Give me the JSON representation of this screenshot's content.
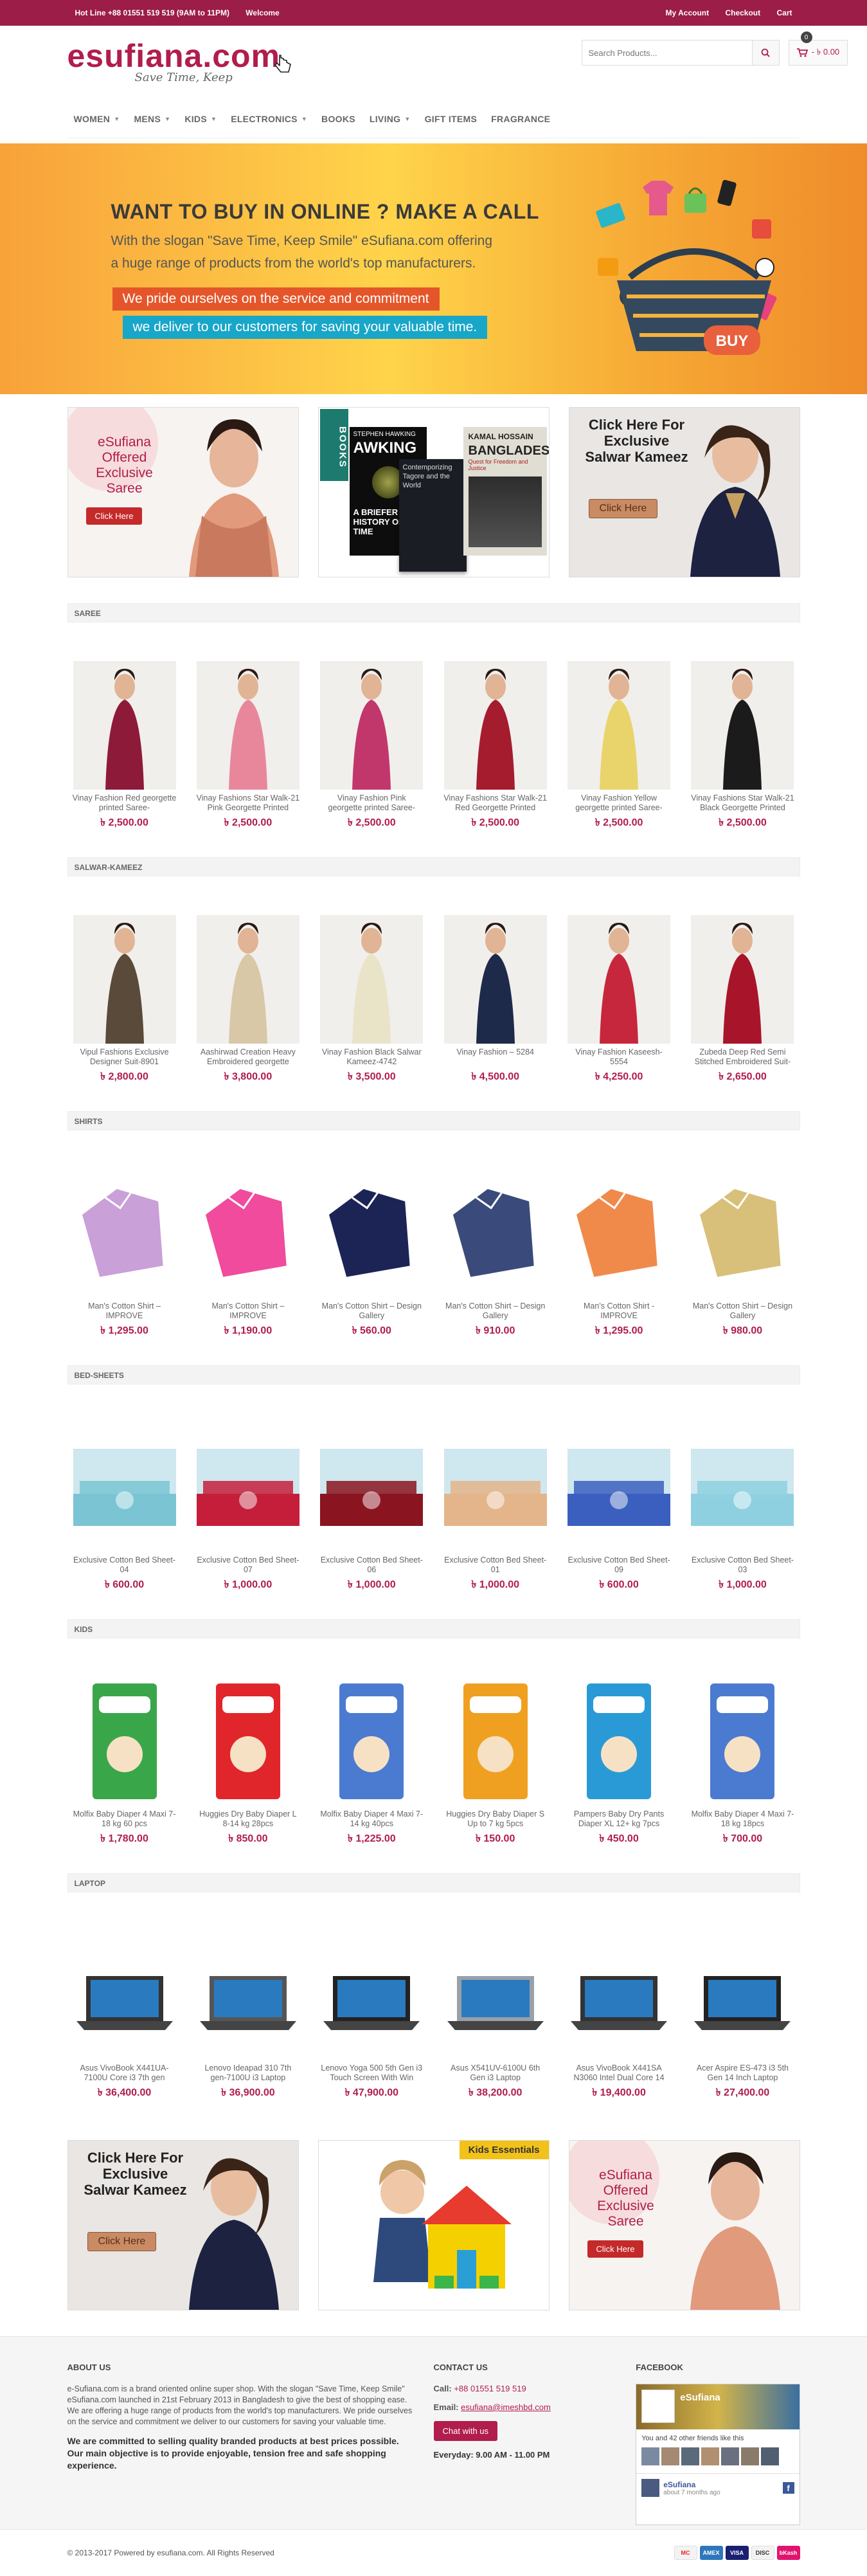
{
  "topbar": {
    "hotline": "Hot Line +88 01551 519 519 (9AM to 11PM)",
    "welcome": "Welcome",
    "my_account": "My Account",
    "checkout": "Checkout",
    "cart": "Cart"
  },
  "header": {
    "logo_text": "esufiana.com",
    "logo_tagline": "Save Time, Keep",
    "search_placeholder": "Search Products...",
    "cart_count": "0",
    "cart_total": "- ৳ 0.00"
  },
  "nav": [
    {
      "label": "WOMEN",
      "dropdown": true
    },
    {
      "label": "MENS",
      "dropdown": true
    },
    {
      "label": "KIDS",
      "dropdown": true
    },
    {
      "label": "ELECTRONICS",
      "dropdown": true
    },
    {
      "label": "BOOKS",
      "dropdown": false
    },
    {
      "label": "LIVING",
      "dropdown": true
    },
    {
      "label": "GIFT ITEMS",
      "dropdown": false
    },
    {
      "label": "FRAGRANCE",
      "dropdown": false
    }
  ],
  "hero": {
    "heading": "WANT TO BUY IN ONLINE ? MAKE A CALL",
    "line1": "With the slogan \"Save Time, Keep Smile\" eSufiana.com offering",
    "line2": "a huge range of products from the world's top manufacturers.",
    "bar1": "We pride ourselves on the service and commitment",
    "bar2": "we deliver to our customers for saving your valuable time.",
    "buy": "BUY"
  },
  "promos": {
    "saree_text": "eSufiana Offered Exclusive Saree",
    "saree_cta": "Click Here",
    "books_label": "BOOKS",
    "book1": "STEPHEN HAWKING",
    "book1_title": "A BRIEFER HISTORY OF TIME",
    "book2": "Contemporizing Tagore and the World",
    "book3": "KAMAL HOSSAIN",
    "book3_title": "BANGLADESH",
    "book3_sub": "Quest for Freedom and Justice",
    "kameez_text": "Click Here For Exclusive Salwar Kameez",
    "kameez_cta": "Click Here"
  },
  "sections": [
    {
      "title": "SAREE",
      "products": [
        {
          "name": "Vinay Fashion Red georgette printed Saree-",
          "price": "৳ 2,500.00"
        },
        {
          "name": "Vinay Fashions Star Walk-21 Pink Georgette Printed",
          "price": "৳ 2,500.00"
        },
        {
          "name": "Vinay Fashion Pink georgette printed Saree-",
          "price": "৳ 2,500.00"
        },
        {
          "name": "Vinay Fashions Star Walk-21 Red Georgette Printed",
          "price": "৳ 2,500.00"
        },
        {
          "name": "Vinay Fashion Yellow georgette printed Saree-",
          "price": "৳ 2,500.00"
        },
        {
          "name": "Vinay Fashions Star Walk-21 Black Georgette Printed",
          "price": "৳ 2,500.00"
        }
      ]
    },
    {
      "title": "SALWAR-KAMEEZ",
      "products": [
        {
          "name": "Vipul Fashions Exclusive Designer Suit-8901",
          "price": "৳ 2,800.00"
        },
        {
          "name": "Aashirwad Creation Heavy Embroidered georgette",
          "price": "৳ 3,800.00"
        },
        {
          "name": "Vinay Fashion Black Salwar Kameez-4742",
          "price": "৳ 3,500.00"
        },
        {
          "name": "Vinay Fashion – 5284",
          "price": "৳ 4,500.00"
        },
        {
          "name": "Vinay Fashion Kaseesh-5554",
          "price": "৳ 4,250.00"
        },
        {
          "name": "Zubeda Deep Red Semi Stitched Embroidered Suit-",
          "price": "৳ 2,650.00"
        }
      ]
    },
    {
      "title": "SHIRTS",
      "products": [
        {
          "name": "Man's Cotton Shirt – IMPROVE",
          "price": "৳ 1,295.00"
        },
        {
          "name": "Man's Cotton Shirt – IMPROVE",
          "price": "৳ 1,190.00"
        },
        {
          "name": "Man's Cotton Shirt – Design Gallery",
          "price": "৳ 560.00"
        },
        {
          "name": "Man's Cotton Shirt – Design Gallery",
          "price": "৳ 910.00"
        },
        {
          "name": "Man's Cotton Shirt - IMPROVE",
          "price": "৳ 1,295.00"
        },
        {
          "name": "Man's Cotton Shirt – Design Gallery",
          "price": "৳ 980.00"
        }
      ]
    },
    {
      "title": "BED-SHEETS",
      "products": [
        {
          "name": "Exclusive Cotton Bed Sheet-04",
          "price": "৳ 600.00"
        },
        {
          "name": "Exclusive Cotton Bed Sheet-07",
          "price": "৳ 1,000.00"
        },
        {
          "name": "Exclusive Cotton Bed Sheet-06",
          "price": "৳ 1,000.00"
        },
        {
          "name": "Exclusive Cotton Bed Sheet-01",
          "price": "৳ 1,000.00"
        },
        {
          "name": "Exclusive Cotton Bed Sheet-09",
          "price": "৳ 600.00"
        },
        {
          "name": "Exclusive Cotton Bed Sheet-03",
          "price": "৳ 1,000.00"
        }
      ]
    },
    {
      "title": "KIDS",
      "products": [
        {
          "name": "Molfix Baby Diaper 4 Maxi 7-18 kg 60 pcs",
          "price": "৳ 1,780.00"
        },
        {
          "name": "Huggies Dry Baby Diaper L 8-14 kg 28pcs",
          "price": "৳ 850.00"
        },
        {
          "name": "Molfix Baby Diaper 4 Maxi 7-14 kg 40pcs",
          "price": "৳ 1,225.00"
        },
        {
          "name": "Huggies Dry Baby Diaper S Up to 7 kg 5pcs",
          "price": "৳ 150.00"
        },
        {
          "name": "Pampers Baby Dry Pants Diaper XL 12+ kg 7pcs",
          "price": "৳ 450.00"
        },
        {
          "name": "Molfix Baby Diaper 4 Maxi 7-18 kg 18pcs",
          "price": "৳ 700.00"
        }
      ]
    },
    {
      "title": "LAPTOP",
      "products": [
        {
          "name": "Asus VivoBook X441UA-7100U Core i3 7th gen",
          "price": "৳ 36,400.00"
        },
        {
          "name": "Lenovo Ideapad 310 7th gen-7100U i3 Laptop",
          "price": "৳ 36,900.00"
        },
        {
          "name": "Lenovo Yoga 500 5th Gen i3 Touch Screen With Win",
          "price": "৳ 47,900.00"
        },
        {
          "name": "Asus X541UV-6100U 6th Gen i3 Laptop",
          "price": "৳ 38,200.00"
        },
        {
          "name": "Asus VivoBook X441SA N3060 Intel Dual Core 14",
          "price": "৳ 19,400.00"
        },
        {
          "name": "Acer Aspire ES-473 i3 5th Gen 14 Inch Laptop",
          "price": "৳ 27,400.00"
        }
      ]
    }
  ],
  "bottom_promos": {
    "kameez_text": "Click Here For Exclusive Salwar Kameez",
    "kameez_cta": "Click Here",
    "kids_label": "Kids Essentials",
    "saree_text": "eSufiana Offered Exclusive Saree",
    "saree_cta": "Click Here"
  },
  "footer": {
    "about_title": "ABOUT US",
    "about_p1": "e-Sufiana.com is a brand oriented online super shop. With the slogan \"Save Time, Keep Smile\" eSufiana.com launched in 21st February 2013 in Bangladesh to give the best of shopping ease. We are offering a huge range of products from the world's top manufacturers. We pride ourselves on the service and commitment we deliver to our customers for saving your valuable time.",
    "about_p2": "We are committed to selling quality branded products at best prices possible. Our main objective is to  provide enjoyable, tension free and safe shopping experience.",
    "contact_title": "CONTACT US",
    "call_label": "Call:",
    "call_value": "+88 01551 519 519",
    "email_label": "Email:",
    "email_value": "esufiana@imeshbd.com",
    "chat_button": "Chat with us",
    "hours": "Everyday: 9.00 AM - 11.00 PM",
    "fb_title": "FACEBOOK",
    "fb_page": "eSufiana",
    "fb_friends": "You and 42 other friends like this",
    "fb_post_name": "eSufiana",
    "fb_post_time": "about 7 months ago"
  },
  "copyright": {
    "text": "© 2013-2017 Powered by esufiana.com. All Rights Reserved",
    "payments": [
      "MC",
      "AMEX",
      "VISA",
      "DISC",
      "bKash"
    ]
  },
  "colors": {
    "brand": "#9c1d47",
    "price": "#b11d4c",
    "hero_orange": "#f8a23a",
    "hero_red_bar": "#e4562a",
    "hero_blue_bar": "#18a6c9"
  }
}
